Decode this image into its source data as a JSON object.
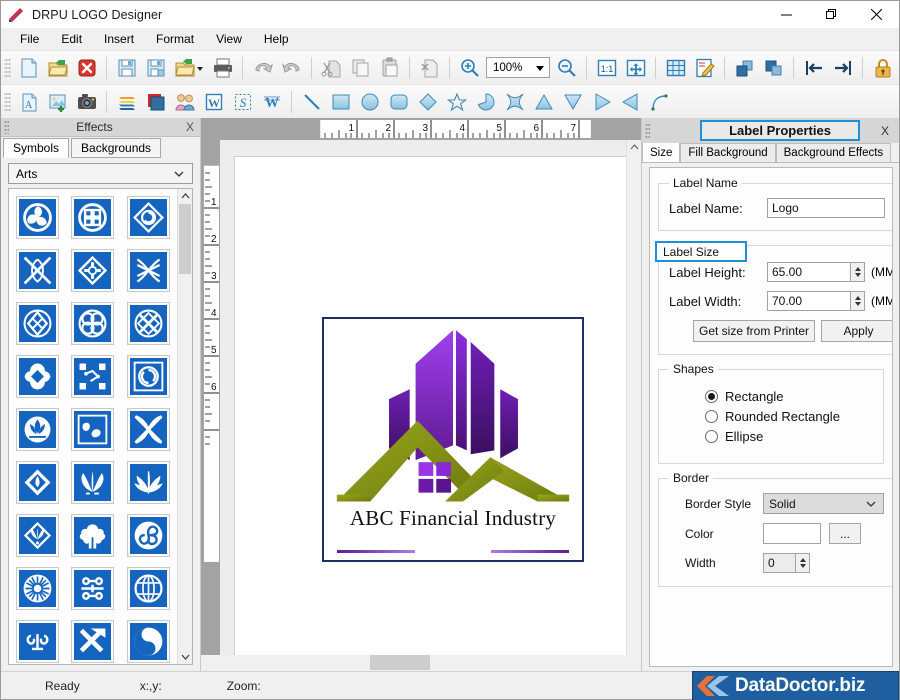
{
  "window": {
    "title": "DRPU LOGO Designer",
    "minimize_label": "minimize",
    "maximize_label": "maximize",
    "close_label": "close"
  },
  "menubar": {
    "items": [
      {
        "label": "File"
      },
      {
        "label": "Edit"
      },
      {
        "label": "Insert"
      },
      {
        "label": "Format"
      },
      {
        "label": "View"
      },
      {
        "label": "Help"
      }
    ]
  },
  "toolbar": {
    "zoom_value": "100%",
    "row1": [
      {
        "name": "new-icon"
      },
      {
        "name": "open-icon"
      },
      {
        "name": "close-document-icon"
      },
      {
        "name": "save-icon"
      },
      {
        "name": "save-as-icon"
      },
      {
        "name": "open-recent-icon"
      },
      {
        "name": "print-icon"
      },
      {
        "name": "undo-icon"
      },
      {
        "name": "redo-icon"
      },
      {
        "name": "cut-icon"
      },
      {
        "name": "copy-icon"
      },
      {
        "name": "paste-icon"
      },
      {
        "name": "delete-icon"
      },
      {
        "name": "zoom-in-icon"
      },
      {
        "name": "zoom-out-icon"
      },
      {
        "name": "actual-size-icon"
      },
      {
        "name": "fit-page-icon"
      },
      {
        "name": "grid-icon"
      },
      {
        "name": "edit-design-icon"
      },
      {
        "name": "bring-front-icon"
      },
      {
        "name": "send-back-icon"
      },
      {
        "name": "align-left-icon"
      },
      {
        "name": "align-right-icon"
      },
      {
        "name": "lock-icon"
      },
      {
        "name": "unlock-icon"
      }
    ],
    "row2": [
      {
        "name": "text-icon"
      },
      {
        "name": "insert-picture-icon"
      },
      {
        "name": "camera-icon"
      },
      {
        "name": "layers-icon"
      },
      {
        "name": "color-palette-icon"
      },
      {
        "name": "clipart-people-icon"
      },
      {
        "name": "word-art-icon"
      },
      {
        "name": "signature-icon"
      },
      {
        "name": "watermark-icon"
      },
      {
        "name": "line-icon"
      },
      {
        "name": "rectangle-icon"
      },
      {
        "name": "ellipse-icon"
      },
      {
        "name": "rounded-rectangle-icon"
      },
      {
        "name": "diamond-icon"
      },
      {
        "name": "star-icon"
      },
      {
        "name": "pie-icon"
      },
      {
        "name": "four-point-star-icon"
      },
      {
        "name": "triangle-icon"
      },
      {
        "name": "inverted-triangle-icon"
      },
      {
        "name": "right-triangle-icon"
      },
      {
        "name": "left-triangle-icon"
      },
      {
        "name": "arc-icon"
      }
    ]
  },
  "effects_panel": {
    "title": "Effects",
    "close_label": "X",
    "tabs": [
      {
        "label": "Symbols",
        "active": true
      },
      {
        "label": "Backgrounds",
        "active": false
      }
    ],
    "category_selected": "Arts",
    "symbols": [
      "triskelion",
      "knot-circle",
      "diamond-spiral",
      "celtic-cross",
      "diamond-cross",
      "interlace-x",
      "diamond-knot",
      "clover-knot",
      "circle-x-knot",
      "quatrefoil",
      "dots-network",
      "square-swirl",
      "lotus-bloom",
      "wave-motif",
      "pinwheel-leaf",
      "diamond-leaf",
      "fan-shell",
      "palm-leaf",
      "diamond-fan",
      "oak-tree",
      "triple-swirl",
      "flower-burst",
      "double-scroll",
      "globe-grid",
      "heart-tree",
      "arrow-cross",
      "yin-swirl"
    ]
  },
  "canvas": {
    "hruler_ticks": [
      "1",
      "2",
      "3",
      "4",
      "5",
      "6",
      "7"
    ],
    "vruler_ticks": [
      "1",
      "2",
      "3",
      "4",
      "5",
      "6"
    ],
    "logo": {
      "text": "ABC Financial Industry",
      "building_color": "#8a2ee0",
      "roof_color": "#8a9b18"
    }
  },
  "label_properties": {
    "title": "Label Properties",
    "close_label": "X",
    "tabs": [
      {
        "label": "Size",
        "active": true
      },
      {
        "label": "Fill Background",
        "active": false
      },
      {
        "label": "Background Effects",
        "active": false
      }
    ],
    "label_name_group": "Label Name",
    "label_name_label": "Label Name:",
    "label_name_value": "Logo",
    "label_size_group": "Label Size",
    "label_height_label": "Label Height:",
    "label_height_value": "65.00",
    "label_height_unit": "(MM)",
    "label_width_label": "Label Width:",
    "label_width_value": "70.00",
    "label_width_unit": "(MM)",
    "get_size_button": "Get size from Printer",
    "apply_button": "Apply",
    "shapes_group": "Shapes",
    "shapes": [
      {
        "label": "Rectangle",
        "selected": true
      },
      {
        "label": "Rounded Rectangle",
        "selected": false
      },
      {
        "label": "Ellipse",
        "selected": false
      }
    ],
    "border_group": "Border",
    "border_style_label": "Border Style",
    "border_style_value": "Solid",
    "color_label": "Color",
    "color_value": "",
    "color_picker_button": "...",
    "width_label": "Width",
    "width_value": "0",
    "highlight_color": "#1e90d8"
  },
  "statusbar": {
    "ready": "Ready",
    "coords": "x:,y:",
    "zoom": "Zoom:",
    "brand": "DataDoctor.biz"
  }
}
